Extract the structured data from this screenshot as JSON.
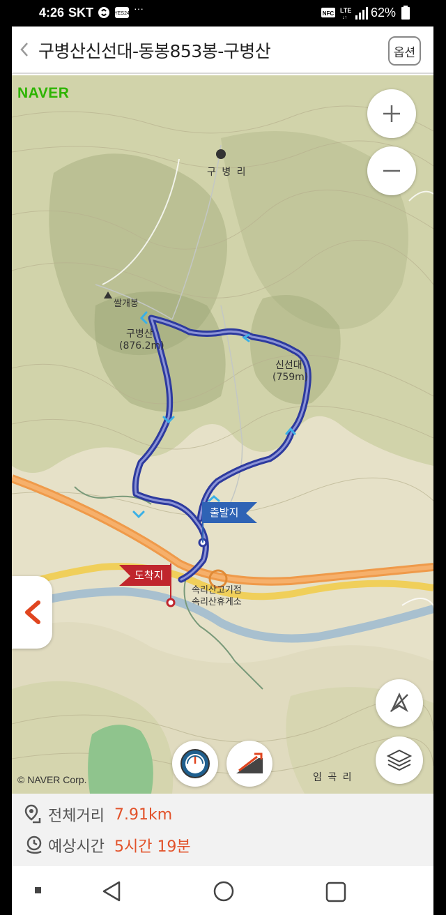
{
  "status_bar": {
    "time": "4:26",
    "carrier": "SKT",
    "battery": "62%"
  },
  "header": {
    "title": "구병산신선대-동봉853봉-구병산",
    "options_label": "옵션"
  },
  "map": {
    "provider_logo": "NAVER",
    "copyright": "© NAVER Corp.",
    "labels": {
      "village_north": "구 병 리",
      "peak_ssalgae": "쌀개봉",
      "peak_gubyeong_name": "구병산",
      "peak_gubyeong_height": "(876.2m)",
      "peak_sinseondae_name": "신선대",
      "peak_sinseondae_height": "(759m)",
      "rest_area_line1": "속리산고기점",
      "rest_area_line2": "속리산휴게소",
      "village_south": "임 곡 리"
    },
    "start_flag": "출발지",
    "end_flag": "도착지",
    "route_color": "#2d3a9e",
    "start_flag_color": "#2f63b5",
    "end_flag_color": "#c0262d"
  },
  "info": {
    "distance_label": "전체거리",
    "distance_value": "7.91km",
    "time_label": "예상시간",
    "time_value": "5시간 19분"
  }
}
